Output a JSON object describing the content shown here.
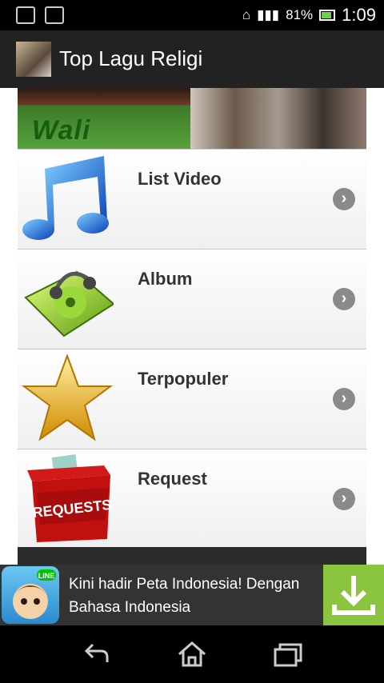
{
  "status_bar": {
    "battery_percent": "81%",
    "time": "1:09"
  },
  "action_bar": {
    "title": "Top Lagu Religi"
  },
  "banner": {
    "logo_text": "Wali"
  },
  "menu": {
    "items": [
      {
        "label": "List Video",
        "icon": "music-note-icon"
      },
      {
        "label": "Album",
        "icon": "album-headphones-icon"
      },
      {
        "label": "Terpopuler",
        "icon": "star-icon"
      },
      {
        "label": "Request",
        "icon": "requests-box-icon"
      }
    ]
  },
  "ad": {
    "text": "Kini hadir Peta Indonesia! Dengan Bahasa Indonesia",
    "badge": "LINE",
    "icon": "line-game-icon",
    "action_icon": "download-icon"
  },
  "colors": {
    "ad_download_bg": "#8bc53f",
    "action_bar": "#222222"
  }
}
